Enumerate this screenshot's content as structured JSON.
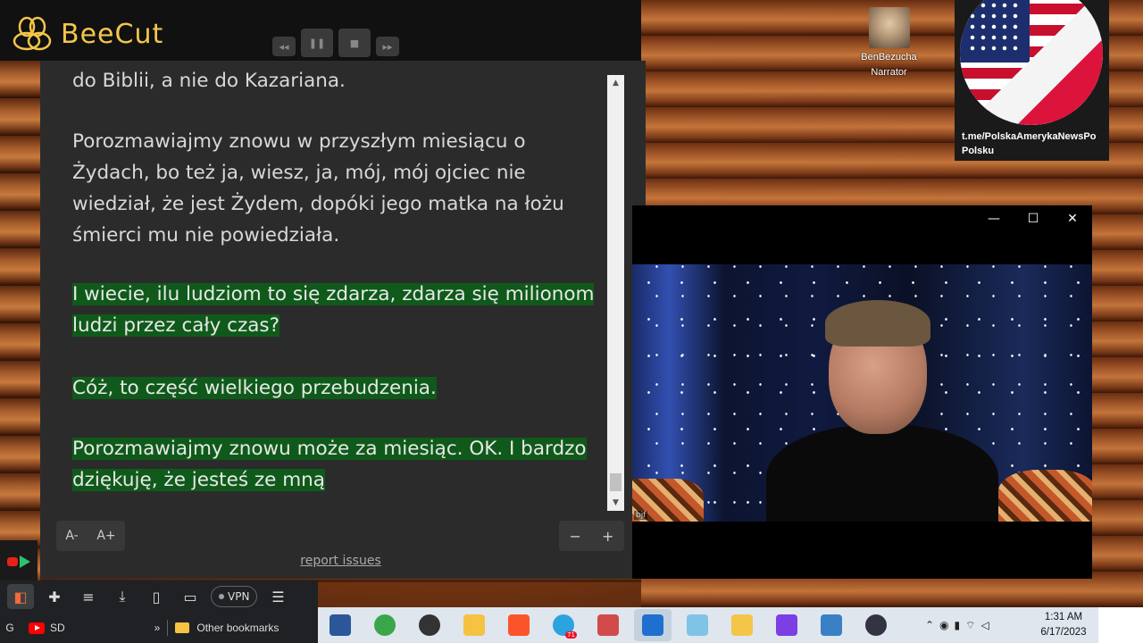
{
  "app": {
    "brand": "BeeCut"
  },
  "transcript": {
    "paragraphs": [
      {
        "text": "do Biblii, a nie do Kazariana.",
        "highlighted": false
      },
      {
        "text": "Porozmawiajmy znowu w przyszłym miesiącu o Żydach, bo też ja, wiesz, ja, mój, mój ojciec nie wiedział, że jest Żydem, dopóki jego matka na łożu śmierci mu nie powiedziała.",
        "highlighted": false
      },
      {
        "text": "I wiecie, ilu ludziom to się zdarza, zdarza się milionom ludzi przez cały czas?",
        "highlighted": true
      },
      {
        "text": "Cóż, to część wielkiego przebudzenia.",
        "highlighted": true
      },
      {
        "text": "Porozmawiajmy znowu może za miesiąc. OK. I bardzo dziękuję, że jesteś ze mną",
        "highlighted": true
      }
    ],
    "font_decrease": "A-",
    "font_increase": "A+",
    "zoom_out": "−",
    "zoom_in": "+",
    "report_link": "report issues"
  },
  "narrator": {
    "name": "BenBezucha",
    "role": "Narrator"
  },
  "flag_card": {
    "line1": "t.me/PolskaAmerykaNewsPo",
    "line2": "Polsku"
  },
  "video_window": {
    "minimize": "—",
    "maximize": "☐",
    "close": "✕",
    "watermark": "bjf"
  },
  "browser": {
    "vpn_label": "VPN",
    "bookmarks": {
      "g": "G",
      "sd": "SD",
      "more": "»",
      "other": "Other bookmarks"
    }
  },
  "taskbar": {
    "telegram_badge": "71",
    "time": "1:31 AM",
    "date": "6/17/2023"
  },
  "colors": {
    "highlight": "#0f5a1a",
    "brand": "#f3c64a",
    "panel": "#2b2b2b"
  }
}
